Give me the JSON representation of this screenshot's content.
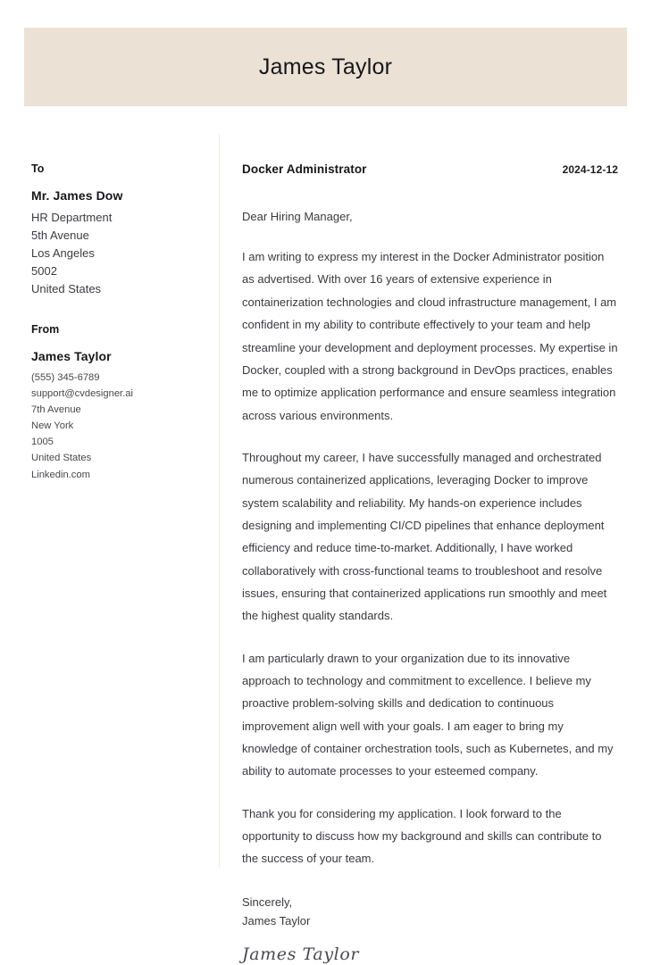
{
  "header": {
    "name": "James Taylor",
    "band_color": "#ece1d5"
  },
  "recipient": {
    "heading": "To",
    "name": "Mr. James Dow",
    "lines": [
      "HR Department",
      "5th Avenue",
      "Los Angeles",
      "5002",
      "United States"
    ]
  },
  "sender": {
    "heading": "From",
    "name": "James Taylor",
    "lines": [
      "(555) 345-6789",
      "support@cvdesigner.ai",
      "7th Avenue",
      "New York",
      "1005",
      "United States",
      "Linkedin.com"
    ]
  },
  "letter": {
    "job_title": "Docker Administrator",
    "date": "2024-12-12",
    "salutation": "Dear Hiring Manager,",
    "paragraphs": [
      "I am writing to express my interest in the Docker Administrator position as advertised. With over 16 years of extensive experience in containerization technologies and cloud infrastructure management, I am confident in my ability to contribute effectively to your team and help streamline your development and deployment processes. My expertise in Docker, coupled with a strong background in DevOps practices, enables me to optimize application performance and ensure seamless integration across various environments.",
      "Throughout my career, I have successfully managed and orchestrated numerous containerized applications, leveraging Docker to improve system scalability and reliability. My hands-on experience includes designing and implementing CI/CD pipelines that enhance deployment efficiency and reduce time-to-market. Additionally, I have worked collaboratively with cross-functional teams to troubleshoot and resolve issues, ensuring that containerized applications run smoothly and meet the highest quality standards.",
      "I am particularly drawn to your organization due to its innovative approach to technology and commitment to excellence. I believe my proactive problem-solving skills and dedication to continuous improvement align well with your goals. I am eager to bring my knowledge of container orchestration tools, such as Kubernetes, and my ability to automate processes to your esteemed company.",
      "Thank you for considering my application. I look forward to the opportunity to discuss how my background and skills can contribute to the success of your team."
    ],
    "closing_word": "Sincerely,",
    "closing_name": "James Taylor",
    "signature": "James Taylor"
  }
}
